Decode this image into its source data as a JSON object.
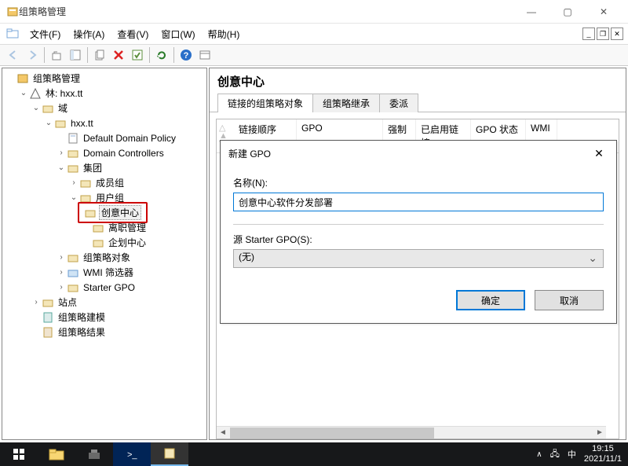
{
  "window": {
    "title": "组策略管理"
  },
  "menu": {
    "file": "文件(F)",
    "action": "操作(A)",
    "view": "查看(V)",
    "window": "窗口(W)",
    "help": "帮助(H)"
  },
  "tree": {
    "root": "组策略管理",
    "forest": "林: hxx.tt",
    "domains": "域",
    "domain": "hxx.tt",
    "ddp": "Default Domain Policy",
    "dc": "Domain Controllers",
    "group": "集团",
    "members": "成员组",
    "userou": "用户组",
    "creative": "创意中心",
    "leave": "离职管理",
    "enterprise": "企划中心",
    "gpoobj": "组策略对象",
    "wmi": "WMI 筛选器",
    "starter": "Starter GPO",
    "sites": "站点",
    "modeling": "组策略建模",
    "results": "组策略结果"
  },
  "content": {
    "title": "创意中心",
    "tabs": {
      "linked": "链接的组策略对象",
      "inherit": "组策略继承",
      "delegate": "委派"
    },
    "cols": {
      "order": "链接顺序",
      "gpo": "GPO",
      "enforced": "强制",
      "enabled": "已启用链接",
      "status": "GPO 状态",
      "wmi": "WMI"
    }
  },
  "dialog": {
    "title": "新建 GPO",
    "name_label": "名称(N):",
    "name_value": "创意中心软件分发部署",
    "source_label": "源 Starter GPO(S):",
    "source_value": "(无)",
    "ok": "确定",
    "cancel": "取消"
  },
  "taskbar": {
    "ime": "中",
    "time": "19:15",
    "date": "2021/11/1"
  }
}
